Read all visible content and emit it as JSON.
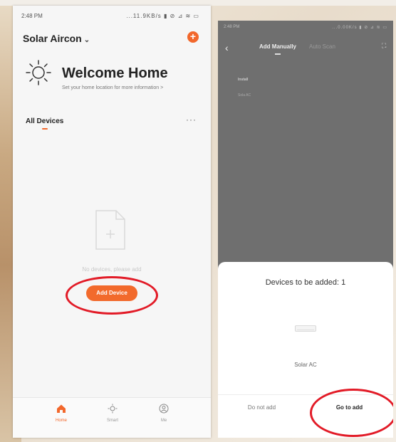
{
  "left": {
    "status": {
      "time": "2:48 PM",
      "icons": "...11.9KB/s ▮ ⊘ ⊿ ≋ ▭"
    },
    "home": {
      "title": "Solar Aircon",
      "chevron": "⌄",
      "add": "+"
    },
    "welcome": {
      "title": "Welcome Home",
      "subtitle": "Set your home location for more information >"
    },
    "devices": {
      "label": "All Devices",
      "more": "···"
    },
    "empty": {
      "text": "No devices, please add",
      "button": "Add Device"
    },
    "tabs": [
      {
        "label": "Home",
        "icon": "home-icon"
      },
      {
        "label": "Smart",
        "icon": "smart-icon"
      },
      {
        "label": "Me",
        "icon": "me-icon"
      }
    ]
  },
  "right": {
    "status": {
      "time": "2:48 PM",
      "icons": "...0.00K/s ▮ ⊘ ⊿ ≋ ▭"
    },
    "nav": {
      "back": "‹",
      "tab_manual": "Add Manually",
      "tab_auto": "Auto Scan",
      "scan": "⛶"
    },
    "list": {
      "item1": "Install",
      "item2": "Sola AC"
    },
    "sheet": {
      "title": "Devices to be added: 1",
      "device_name": "Solar AC",
      "cancel": "Do not add",
      "confirm": "Go to add"
    }
  },
  "colors": {
    "accent": "#f2672b",
    "highlight": "#e21b27"
  }
}
